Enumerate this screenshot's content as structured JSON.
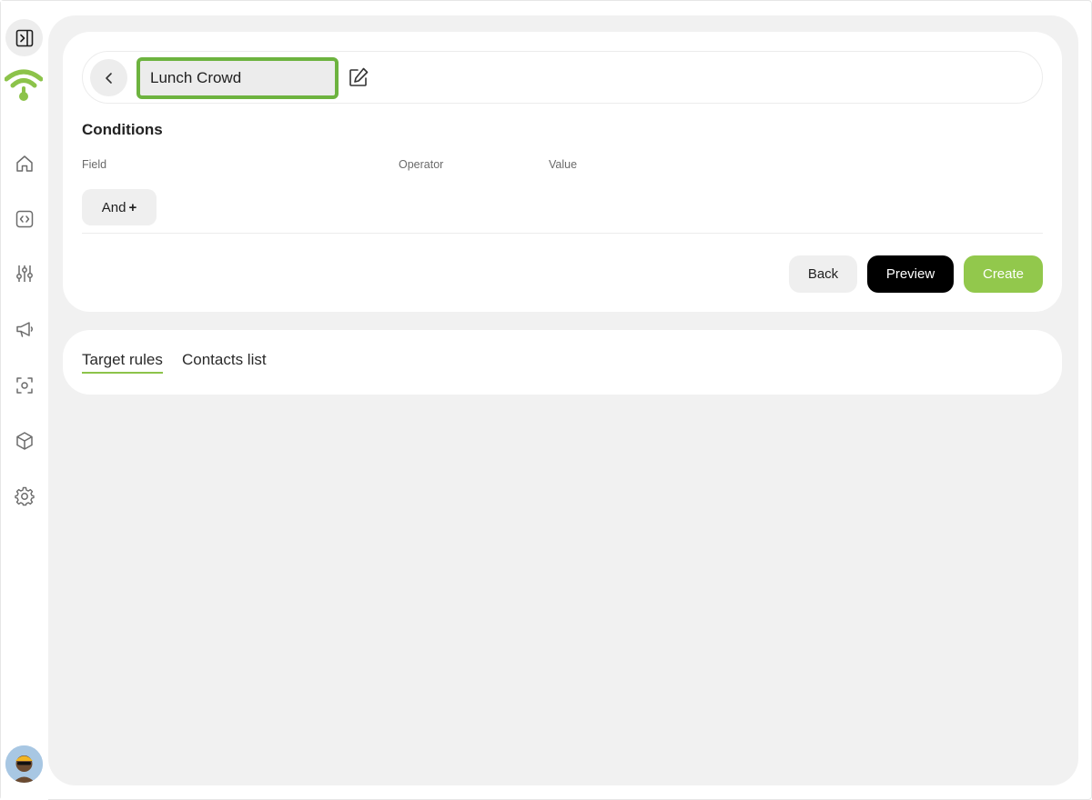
{
  "segment": {
    "name_value": "Lunch Crowd"
  },
  "conditions": {
    "title": "Conditions",
    "columns": {
      "field": "Field",
      "operator": "Operator",
      "value": "Value"
    },
    "and_label": "And",
    "and_plus": "+"
  },
  "actions": {
    "back_label": "Back",
    "preview_label": "Preview",
    "create_label": "Create"
  },
  "tabs": [
    {
      "label": "Target rules",
      "active": true
    },
    {
      "label": "Contacts list",
      "active": false
    }
  ],
  "sidebar": {
    "items": [
      {
        "icon": "home-icon"
      },
      {
        "icon": "code-icon"
      },
      {
        "icon": "sliders-icon"
      },
      {
        "icon": "megaphone-icon"
      },
      {
        "icon": "scan-icon"
      },
      {
        "icon": "cube-icon"
      },
      {
        "icon": "gear-icon"
      }
    ]
  },
  "colors": {
    "accent": "#92c84c",
    "input_border": "#6db33f",
    "primary_button": "#000000",
    "main_background": "#f1f1f1"
  }
}
